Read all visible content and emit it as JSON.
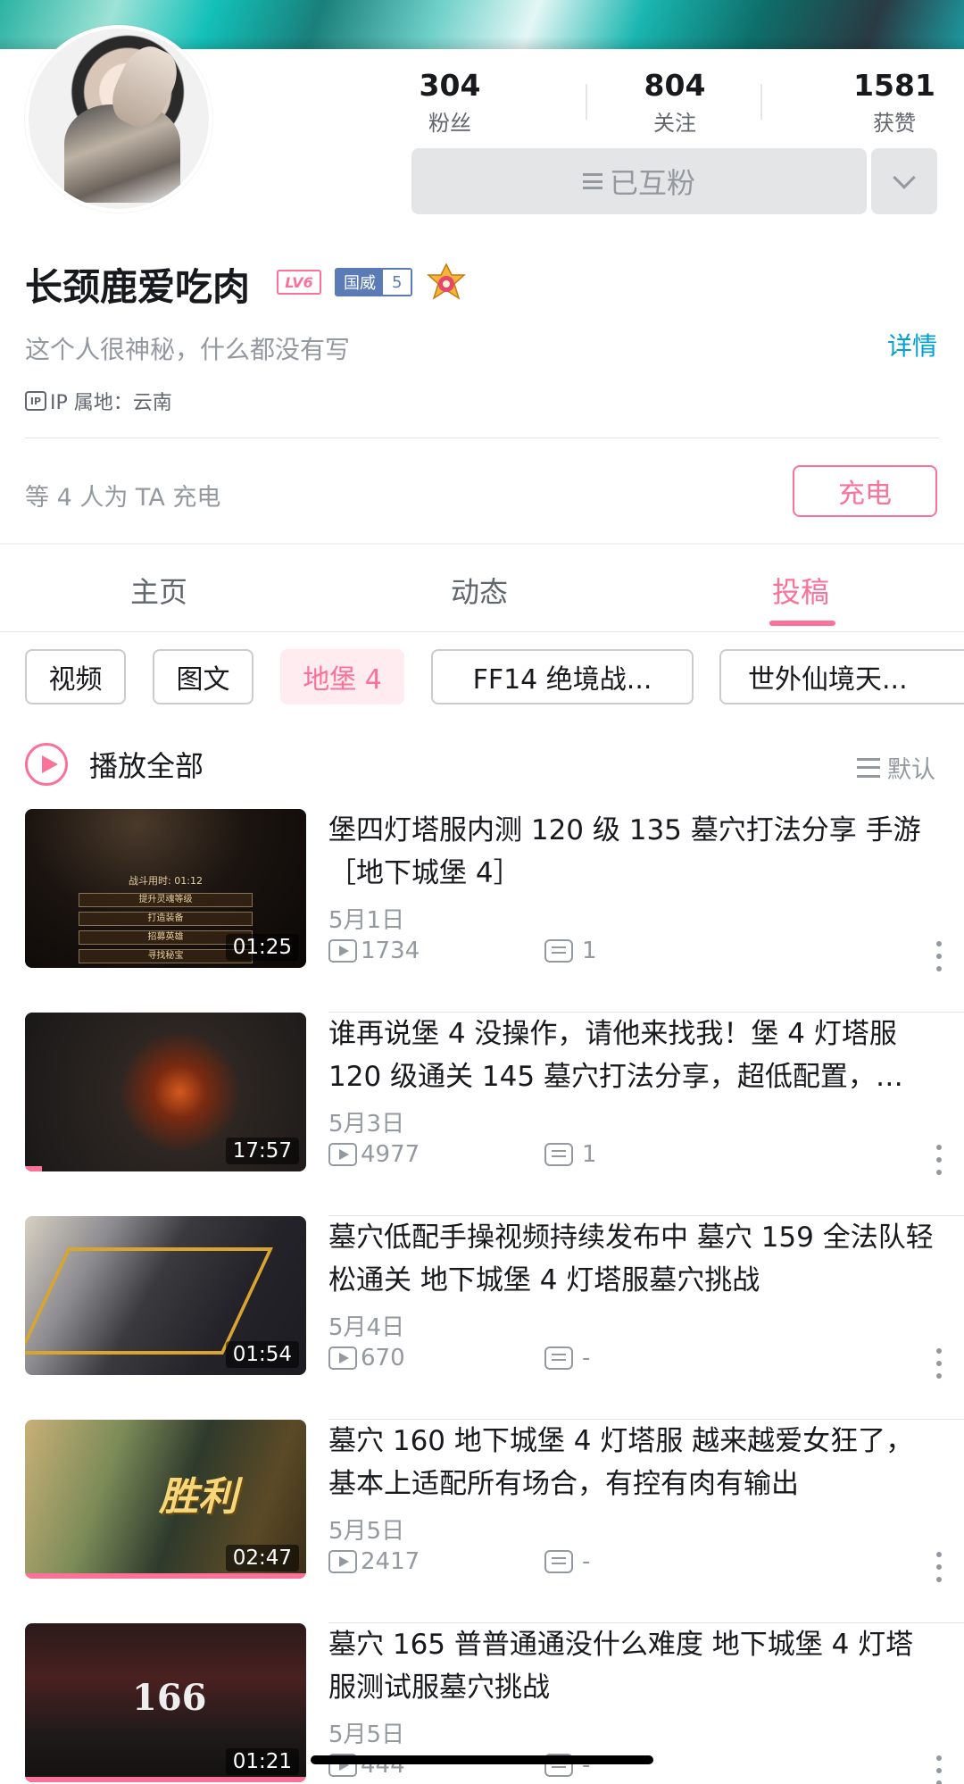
{
  "profile": {
    "name": "长颈鹿爱吃肉",
    "level_badge": "LV6",
    "medal": {
      "name": "国威",
      "level": "5"
    },
    "bio": "这个人很神秘，什么都没有写",
    "detail_link": "详情",
    "ip_icon": "IP",
    "ip_location": "IP 属地：云南"
  },
  "stats": {
    "fans_count": "304",
    "fans_label": "粉丝",
    "follow_count": "804",
    "follow_label": "关注",
    "likes_count": "1581",
    "likes_label": "获赞"
  },
  "follow_button": {
    "label": "已互粉"
  },
  "charge": {
    "text": "等 4 人为 TA 充电",
    "button": "充电"
  },
  "tabs": [
    {
      "label": "主页"
    },
    {
      "label": "动态"
    },
    {
      "label": "投稿",
      "active": true
    }
  ],
  "filters": [
    {
      "label": "视频"
    },
    {
      "label": "图文"
    },
    {
      "label": "地堡 4",
      "active": true
    },
    {
      "label": "FF14 绝境战..."
    },
    {
      "label": "世外仙境天..."
    }
  ],
  "play_all": {
    "label": "播放全部",
    "sort_label": "默认"
  },
  "videos": [
    {
      "title": "堡四灯塔服内测 120 级 135 墓穴打法分享 手游［地下城堡 4］",
      "date": "5月1日",
      "plays": "1734",
      "comments": "1",
      "duration": "01:25",
      "watched_fraction": 0
    },
    {
      "title": "谁再说堡 4 没操作，请他来找我！堡 4 灯塔服 120 级通关 145 墓穴打法分享，超低配置，…",
      "date": "5月3日",
      "plays": "4977",
      "comments": "1",
      "duration": "17:57",
      "watched_fraction": 0.06
    },
    {
      "title": "墓穴低配手操视频持续发布中 墓穴 159 全法队轻松通关 地下城堡 4 灯塔服墓穴挑战",
      "date": "5月4日",
      "plays": "670",
      "comments": "-",
      "duration": "01:54",
      "watched_fraction": 0
    },
    {
      "title": "墓穴 160 地下城堡 4 灯塔服 越来越爱女狂了，基本上适配所有场合，有控有肉有输出",
      "date": "5月5日",
      "plays": "2417",
      "comments": "-",
      "duration": "02:47",
      "watched_fraction": 1.0
    },
    {
      "title": "墓穴 165 普普通通没什么难度 地下城堡 4 灯塔服测试服墓穴挑战",
      "date": "5月5日",
      "plays": "444",
      "comments": "-",
      "duration": "01:21",
      "watched_fraction": 1.0
    }
  ],
  "thumb_text": {
    "t1_timer": "战斗用时: 01:12",
    "t1_menu": [
      "提升灵魂等级",
      "打造装备",
      "招募英雄",
      "寻找秘宝"
    ],
    "t4_win": "胜利",
    "t5_num": "166"
  },
  "colors": {
    "accent": "#fb7299",
    "link": "#00a1d6",
    "text_secondary": "#9499a0"
  },
  "icons": [
    "menu-lines-icon",
    "chevron-down-icon",
    "play-circle-icon",
    "sort-lines-icon",
    "play-count-icon",
    "comment-icon",
    "more-dots-icon",
    "ip-icon"
  ]
}
